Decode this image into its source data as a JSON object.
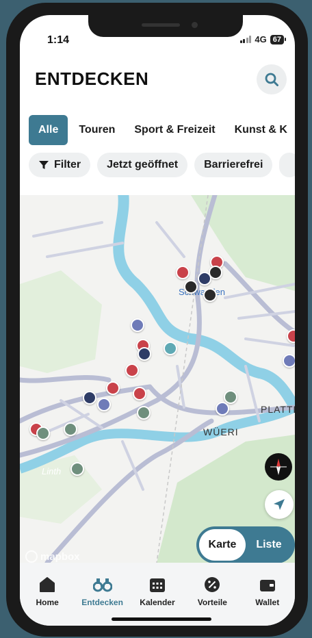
{
  "status": {
    "time": "1:14",
    "network": "4G",
    "battery": "67"
  },
  "header": {
    "title": "ENTDECKEN"
  },
  "tabs": [
    {
      "label": "Alle",
      "active": true
    },
    {
      "label": "Touren",
      "active": false
    },
    {
      "label": "Sport & Freizeit",
      "active": false
    },
    {
      "label": "Kunst & K",
      "active": false
    }
  ],
  "filters": [
    {
      "label": "Filter",
      "icon": "funnel-icon"
    },
    {
      "label": "Jetzt geöffnet"
    },
    {
      "label": "Barrierefrei"
    },
    {
      "label": ""
    }
  ],
  "map": {
    "labels": {
      "district_1": "PLATTEN",
      "district_2": "WÜERI",
      "river": "Linth",
      "town": "Schwanden"
    },
    "attribution": "mapbox"
  },
  "view_toggle": {
    "options": [
      "Karte",
      "Liste"
    ],
    "selected": "Karte"
  },
  "nav": [
    {
      "label": "Home",
      "icon": "home-icon",
      "active": false
    },
    {
      "label": "Entdecken",
      "icon": "binoculars-icon",
      "active": true
    },
    {
      "label": "Kalender",
      "icon": "calendar-icon",
      "active": false
    },
    {
      "label": "Vorteile",
      "icon": "percent-icon",
      "active": false
    },
    {
      "label": "Wallet",
      "icon": "wallet-icon",
      "active": false
    }
  ],
  "colors": {
    "accent": "#3e7a92",
    "river": "#8fd0e6",
    "park": "#d8ebd2",
    "road": "#b9bdd4"
  }
}
